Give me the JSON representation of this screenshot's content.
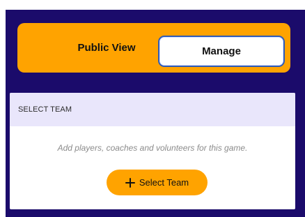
{
  "view_toggle": {
    "public_view_label": "Public View",
    "manage_label": "Manage",
    "selected": "Manage"
  },
  "select_team_card": {
    "header_title": "SELECT TEAM",
    "helper_text": "Add players, coaches and volunteers for this game.",
    "button_label": "Select Team",
    "button_icon": "plus-icon"
  },
  "colors": {
    "panel_background": "#1b0b6b",
    "accent": "#ffa300",
    "header_background": "#e9e6fb",
    "selected_border": "#2f5bb7"
  }
}
